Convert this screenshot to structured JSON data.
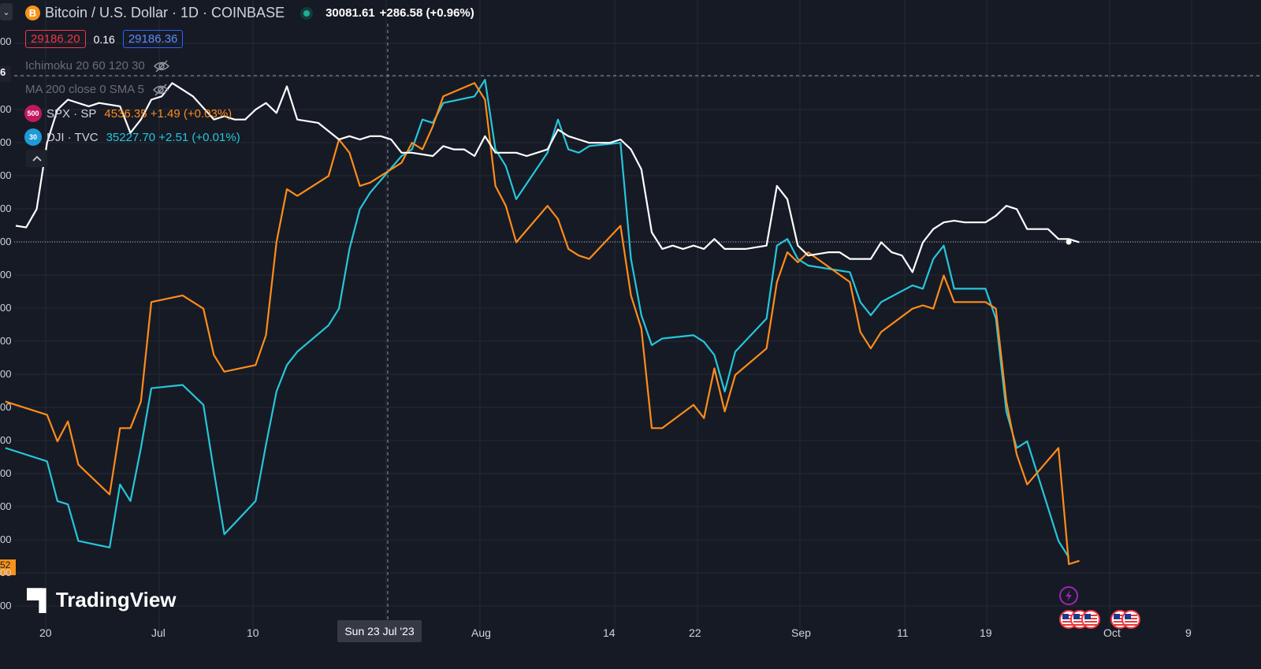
{
  "header": {
    "symbol_icon": "B",
    "symbol": "Bitcoin / U.S. Dollar · 1D · COINBASE",
    "last": "30081.61",
    "change": "+286.58 (+0.96%)",
    "bid": "29186.20",
    "spread": "0.16",
    "ask": "29186.36",
    "status_icon": "market-open-dot-icon",
    "menu_icon": "chevron-down-icon"
  },
  "indicators": [
    {
      "label": "Ichimoku 20 60 120 30",
      "icon": "eye-hidden-icon"
    },
    {
      "label": "MA 200 close 0 SMA 5",
      "icon": "eye-hidden-icon"
    }
  ],
  "compare": [
    {
      "badge": "500",
      "symbol": "SPX · SP",
      "value": "4536.35 +1.49 (+0.03%)",
      "color": "#ff8c1a",
      "badge_color": "#c2185b"
    },
    {
      "badge": "30",
      "symbol": "DJI · TVC",
      "value": "35227.70 +2.51 (+0.01%)",
      "color": "#26c6da",
      "badge_color": "#1e9bd7"
    }
  ],
  "collapse_icon": "chevron-up-icon",
  "logo": {
    "text": "TradingView"
  },
  "x_axis": {
    "ticks": [
      "20",
      "Jul",
      "10",
      "Aug",
      "14",
      "22",
      "Sep",
      "11",
      "19",
      "Oct",
      "9"
    ],
    "cursor_label": "Sun 23 Jul '23"
  },
  "y_axis": {
    "fragments": [
      "00",
      "00",
      "00",
      "00",
      "00",
      "00",
      "00",
      "00",
      "00",
      "00",
      "00",
      "00",
      "00",
      "00",
      "00",
      "00",
      "00",
      "00"
    ],
    "cursor_value": "6",
    "price_tag": "52"
  },
  "colors": {
    "btc": "#ffffff",
    "spx": "#ff8c1a",
    "dji": "#26c6da",
    "background": "#161a25",
    "grid": "#262a35"
  },
  "events": {
    "lightning_icon": "lightning-icon",
    "us_flag_icon": "us-flag-icon"
  },
  "chart_data": {
    "type": "line",
    "title": "Bitcoin / U.S. Dollar · 1D · COINBASE",
    "x_range": [
      "2023-06-17",
      "2023-10-14"
    ],
    "grid": true,
    "legend_position": "top-left",
    "series": [
      {
        "name": "BTCUSD",
        "color": "#ffffff",
        "points": [
          [
            "2023-06-17",
            4.5
          ],
          [
            "2023-06-18",
            4.55
          ],
          [
            "2023-06-19",
            4.0
          ],
          [
            "2023-06-20",
            2.0
          ],
          [
            "2023-06-21",
            1.0
          ],
          [
            "2023-06-22",
            0.7
          ],
          [
            "2023-06-24",
            0.9
          ],
          [
            "2023-06-25",
            0.8
          ],
          [
            "2023-06-27",
            0.9
          ],
          [
            "2023-06-28",
            1.7
          ],
          [
            "2023-06-29",
            1.3
          ],
          [
            "2023-06-30",
            0.7
          ],
          [
            "2023-07-01",
            0.6
          ],
          [
            "2023-07-02",
            0.2
          ],
          [
            "2023-07-03",
            0.4
          ],
          [
            "2023-07-04",
            0.6
          ],
          [
            "2023-07-06",
            1.3
          ],
          [
            "2023-07-07",
            1.2
          ],
          [
            "2023-07-08",
            1.3
          ],
          [
            "2023-07-09",
            1.3
          ],
          [
            "2023-07-10",
            1.0
          ],
          [
            "2023-07-11",
            0.8
          ],
          [
            "2023-07-12",
            1.1
          ],
          [
            "2023-07-13",
            0.3
          ],
          [
            "2023-07-14",
            1.3
          ],
          [
            "2023-07-16",
            1.4
          ],
          [
            "2023-07-18",
            1.9
          ],
          [
            "2023-07-19",
            1.8
          ],
          [
            "2023-07-20",
            1.9
          ],
          [
            "2023-07-21",
            1.8
          ],
          [
            "2023-07-22",
            1.8
          ],
          [
            "2023-07-23",
            1.9
          ],
          [
            "2023-07-24",
            2.3
          ],
          [
            "2023-07-25",
            2.3
          ],
          [
            "2023-07-27",
            2.4
          ],
          [
            "2023-07-28",
            2.1
          ],
          [
            "2023-07-29",
            2.2
          ],
          [
            "2023-07-30",
            2.2
          ],
          [
            "2023-07-31",
            2.4
          ],
          [
            "2023-08-01",
            1.8
          ],
          [
            "2023-08-02",
            2.3
          ],
          [
            "2023-08-04",
            2.3
          ],
          [
            "2023-08-05",
            2.4
          ],
          [
            "2023-08-06",
            2.3
          ],
          [
            "2023-08-07",
            2.2
          ],
          [
            "2023-08-08",
            1.6
          ],
          [
            "2023-08-09",
            1.8
          ],
          [
            "2023-08-10",
            1.9
          ],
          [
            "2023-08-11",
            2.0
          ],
          [
            "2023-08-13",
            2.0
          ],
          [
            "2023-08-14",
            1.9
          ],
          [
            "2023-08-15",
            2.2
          ],
          [
            "2023-08-16",
            2.8
          ],
          [
            "2023-08-17",
            4.7
          ],
          [
            "2023-08-18",
            5.2
          ],
          [
            "2023-08-19",
            5.1
          ],
          [
            "2023-08-20",
            5.2
          ],
          [
            "2023-08-21",
            5.1
          ],
          [
            "2023-08-22",
            5.2
          ],
          [
            "2023-08-23",
            4.9
          ],
          [
            "2023-08-24",
            5.2
          ],
          [
            "2023-08-25",
            5.2
          ],
          [
            "2023-08-26",
            5.2
          ],
          [
            "2023-08-28",
            5.1
          ],
          [
            "2023-08-29",
            3.3
          ],
          [
            "2023-08-30",
            3.7
          ],
          [
            "2023-08-31",
            5.1
          ],
          [
            "2023-09-01",
            5.4
          ],
          [
            "2023-09-03",
            5.3
          ],
          [
            "2023-09-04",
            5.3
          ],
          [
            "2023-09-05",
            5.5
          ],
          [
            "2023-09-07",
            5.5
          ],
          [
            "2023-09-08",
            5.0
          ],
          [
            "2023-09-09",
            5.3
          ],
          [
            "2023-09-10",
            5.4
          ],
          [
            "2023-09-11",
            5.9
          ],
          [
            "2023-09-12",
            5.0
          ],
          [
            "2023-09-13",
            4.6
          ],
          [
            "2023-09-14",
            4.4
          ],
          [
            "2023-09-15",
            4.35
          ],
          [
            "2023-09-16",
            4.4
          ],
          [
            "2023-09-17",
            4.4
          ],
          [
            "2023-09-18",
            4.4
          ],
          [
            "2023-09-19",
            4.2
          ],
          [
            "2023-09-20",
            3.9
          ],
          [
            "2023-09-21",
            4.0
          ],
          [
            "2023-09-22",
            4.6
          ],
          [
            "2023-09-23",
            4.6
          ],
          [
            "2023-09-24",
            4.6
          ],
          [
            "2023-09-25",
            4.9
          ],
          [
            "2023-09-26",
            4.9
          ],
          [
            "2023-09-27",
            5.0
          ]
        ]
      },
      {
        "name": "SPX",
        "color": "#ff8c1a",
        "points": [
          [
            "2023-06-16",
            9.8
          ],
          [
            "2023-06-20",
            10.2
          ],
          [
            "2023-06-21",
            11.0
          ],
          [
            "2023-06-22",
            10.4
          ],
          [
            "2023-06-23",
            11.7
          ],
          [
            "2023-06-26",
            12.6
          ],
          [
            "2023-06-27",
            10.6
          ],
          [
            "2023-06-28",
            10.6
          ],
          [
            "2023-06-29",
            9.8
          ],
          [
            "2023-06-30",
            6.8
          ],
          [
            "2023-07-03",
            6.6
          ],
          [
            "2023-07-05",
            7.0
          ],
          [
            "2023-07-06",
            8.4
          ],
          [
            "2023-07-07",
            8.9
          ],
          [
            "2023-07-10",
            8.7
          ],
          [
            "2023-07-11",
            7.8
          ],
          [
            "2023-07-12",
            5.0
          ],
          [
            "2023-07-13",
            3.4
          ],
          [
            "2023-07-14",
            3.6
          ],
          [
            "2023-07-17",
            3.0
          ],
          [
            "2023-07-18",
            1.9
          ],
          [
            "2023-07-19",
            2.3
          ],
          [
            "2023-07-20",
            3.3
          ],
          [
            "2023-07-21",
            3.2
          ],
          [
            "2023-07-24",
            2.6
          ],
          [
            "2023-07-25",
            2.0
          ],
          [
            "2023-07-26",
            2.2
          ],
          [
            "2023-07-27",
            1.5
          ],
          [
            "2023-07-28",
            0.6
          ],
          [
            "2023-07-31",
            0.2
          ],
          [
            "2023-08-01",
            0.7
          ],
          [
            "2023-08-02",
            3.3
          ],
          [
            "2023-08-03",
            3.9
          ],
          [
            "2023-08-04",
            5.0
          ],
          [
            "2023-08-07",
            3.9
          ],
          [
            "2023-08-08",
            4.3
          ],
          [
            "2023-08-09",
            5.2
          ],
          [
            "2023-08-10",
            5.4
          ],
          [
            "2023-08-11",
            5.5
          ],
          [
            "2023-08-14",
            4.5
          ],
          [
            "2023-08-15",
            6.6
          ],
          [
            "2023-08-16",
            7.6
          ],
          [
            "2023-08-17",
            10.6
          ],
          [
            "2023-08-18",
            10.6
          ],
          [
            "2023-08-21",
            9.9
          ],
          [
            "2023-08-22",
            10.3
          ],
          [
            "2023-08-23",
            8.8
          ],
          [
            "2023-08-24",
            10.1
          ],
          [
            "2023-08-25",
            9.0
          ],
          [
            "2023-08-28",
            8.2
          ],
          [
            "2023-08-29",
            6.2
          ],
          [
            "2023-08-30",
            5.3
          ],
          [
            "2023-08-31",
            5.6
          ],
          [
            "2023-09-01",
            5.3
          ],
          [
            "2023-09-05",
            6.2
          ],
          [
            "2023-09-06",
            7.7
          ],
          [
            "2023-09-07",
            8.2
          ],
          [
            "2023-09-08",
            7.7
          ],
          [
            "2023-09-11",
            7.0
          ],
          [
            "2023-09-12",
            6.9
          ],
          [
            "2023-09-13",
            7.0
          ],
          [
            "2023-09-14",
            6.0
          ],
          [
            "2023-09-15",
            6.8
          ],
          [
            "2023-09-18",
            6.8
          ],
          [
            "2023-09-19",
            7.0
          ],
          [
            "2023-09-20",
            9.8
          ],
          [
            "2023-09-21",
            11.4
          ],
          [
            "2023-09-22",
            12.3
          ],
          [
            "2023-09-25",
            11.2
          ],
          [
            "2023-09-26",
            14.7
          ],
          [
            "2023-09-27",
            14.6
          ]
        ]
      },
      {
        "name": "DJI",
        "color": "#26c6da",
        "points": [
          [
            "2023-06-16",
            11.2
          ],
          [
            "2023-06-20",
            11.6
          ],
          [
            "2023-06-21",
            12.8
          ],
          [
            "2023-06-22",
            12.9
          ],
          [
            "2023-06-23",
            14.0
          ],
          [
            "2023-06-26",
            14.2
          ],
          [
            "2023-06-27",
            12.3
          ],
          [
            "2023-06-28",
            12.8
          ],
          [
            "2023-06-29",
            11.2
          ],
          [
            "2023-06-30",
            9.4
          ],
          [
            "2023-07-03",
            9.3
          ],
          [
            "2023-07-05",
            9.9
          ],
          [
            "2023-07-06",
            11.9
          ],
          [
            "2023-07-07",
            13.8
          ],
          [
            "2023-07-10",
            12.8
          ],
          [
            "2023-07-11",
            11.1
          ],
          [
            "2023-07-12",
            9.5
          ],
          [
            "2023-07-13",
            8.7
          ],
          [
            "2023-07-14",
            8.3
          ],
          [
            "2023-07-17",
            7.5
          ],
          [
            "2023-07-18",
            7.0
          ],
          [
            "2023-07-19",
            5.2
          ],
          [
            "2023-07-20",
            4.0
          ],
          [
            "2023-07-21",
            3.5
          ],
          [
            "2023-07-24",
            2.4
          ],
          [
            "2023-07-25",
            2.2
          ],
          [
            "2023-07-26",
            1.3
          ],
          [
            "2023-07-27",
            1.4
          ],
          [
            "2023-07-28",
            0.8
          ],
          [
            "2023-07-31",
            0.6
          ],
          [
            "2023-08-01",
            0.1
          ],
          [
            "2023-08-02",
            2.2
          ],
          [
            "2023-08-03",
            2.7
          ],
          [
            "2023-08-04",
            3.7
          ],
          [
            "2023-08-07",
            2.3
          ],
          [
            "2023-08-08",
            1.3
          ],
          [
            "2023-08-09",
            2.2
          ],
          [
            "2023-08-10",
            2.3
          ],
          [
            "2023-08-11",
            2.1
          ],
          [
            "2023-08-14",
            2.0
          ],
          [
            "2023-08-15",
            5.5
          ],
          [
            "2023-08-16",
            7.2
          ],
          [
            "2023-08-17",
            8.1
          ],
          [
            "2023-08-18",
            7.9
          ],
          [
            "2023-08-21",
            7.8
          ],
          [
            "2023-08-22",
            8.0
          ],
          [
            "2023-08-23",
            8.4
          ],
          [
            "2023-08-24",
            9.5
          ],
          [
            "2023-08-25",
            8.3
          ],
          [
            "2023-08-28",
            7.3
          ],
          [
            "2023-08-29",
            5.1
          ],
          [
            "2023-08-30",
            4.9
          ],
          [
            "2023-08-31",
            5.5
          ],
          [
            "2023-09-01",
            5.7
          ],
          [
            "2023-09-05",
            5.9
          ],
          [
            "2023-09-06",
            6.8
          ],
          [
            "2023-09-07",
            7.2
          ],
          [
            "2023-09-08",
            6.8
          ],
          [
            "2023-09-11",
            6.3
          ],
          [
            "2023-09-12",
            6.4
          ],
          [
            "2023-09-13",
            5.5
          ],
          [
            "2023-09-14",
            5.1
          ],
          [
            "2023-09-15",
            6.4
          ],
          [
            "2023-09-18",
            6.4
          ],
          [
            "2023-09-19",
            7.3
          ],
          [
            "2023-09-20",
            10.1
          ],
          [
            "2023-09-21",
            11.2
          ],
          [
            "2023-09-22",
            11.0
          ],
          [
            "2023-09-25",
            14.0
          ],
          [
            "2023-09-26",
            14.5
          ]
        ]
      }
    ]
  }
}
